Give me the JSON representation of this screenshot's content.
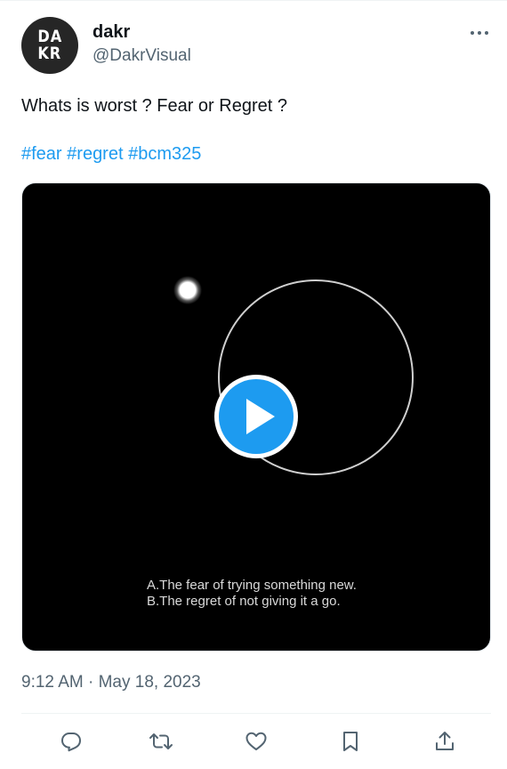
{
  "tweet": {
    "avatar": {
      "line1": "DA",
      "line2": "KR"
    },
    "display_name": "dakr",
    "handle": "@DakrVisual",
    "text": "Whats is worst ? Fear or Regret ?",
    "hashtags": [
      "#fear",
      "#regret",
      "#bcm325"
    ],
    "media": {
      "caption_line1": "A.The fear of trying something new.",
      "caption_line2": "B.The regret of not giving it a go."
    },
    "timestamp": "9:12 AM · May 18, 2023"
  },
  "icons": {
    "more": "more-horizontal-icon",
    "play": "play-icon",
    "reply": "reply-icon",
    "retweet": "retweet-icon",
    "like": "like-icon",
    "bookmark": "bookmark-icon",
    "share": "share-icon"
  },
  "colors": {
    "accent": "#1d9bf0",
    "text_primary": "#0f1419",
    "text_secondary": "#536471",
    "media_background": "#000000"
  }
}
